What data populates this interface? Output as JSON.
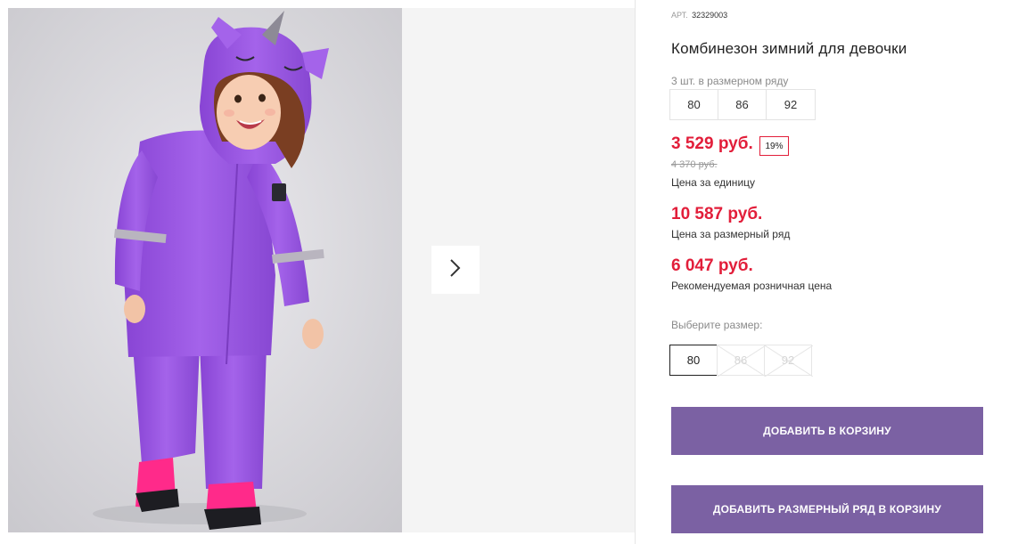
{
  "product": {
    "article_label": "АРТ.",
    "article_number": "32329003",
    "title": "Комбинезон зимний для девочки",
    "size_row_caption": "3 шт. в размерном ряду",
    "size_row": [
      "80",
      "86",
      "92"
    ]
  },
  "pricing": {
    "unit_price": "3 529 руб.",
    "discount": "19%",
    "old_price": "4 370 руб.",
    "unit_price_caption": "Цена за единицу",
    "size_row_price": "10 587 руб.",
    "size_row_price_caption": "Цена за размерный ряд",
    "retail_price": "6 047 руб.",
    "retail_price_caption": "Рекомендуемая розничная цена"
  },
  "size_selector": {
    "label": "Выберите размер:",
    "options": [
      {
        "value": "80",
        "state": "selected"
      },
      {
        "value": "86",
        "state": "unavailable"
      },
      {
        "value": "92",
        "state": "unavailable"
      }
    ]
  },
  "actions": {
    "add_to_cart": "ДОБАВИТЬ В КОРЗИНУ",
    "add_size_row_to_cart": "ДОБАВИТЬ РАЗМЕРНЫЙ РЯД В КОРЗИНУ"
  },
  "gallery": {
    "next_icon": "chevron-right-icon"
  },
  "colors": {
    "price_red": "#e21e3a",
    "button_purple": "#7b61a3",
    "suit_purple": "#9b5be0",
    "boot_pink": "#ff2a8a"
  }
}
